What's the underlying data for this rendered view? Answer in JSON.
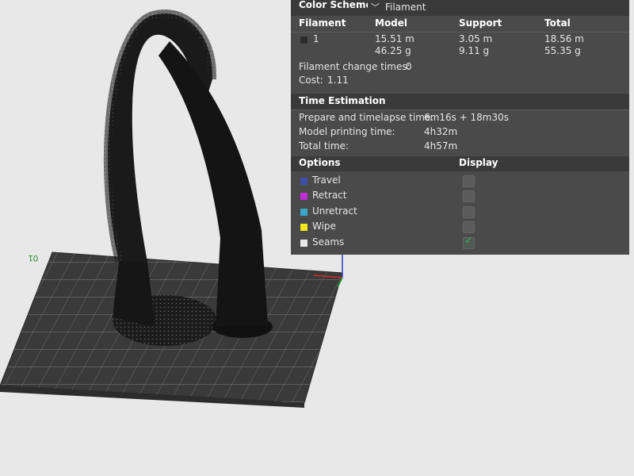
{
  "header": {
    "color_scheme_label": "Color Scheme",
    "color_scheme_value": "Filament"
  },
  "table": {
    "columns": [
      "Filament",
      "Model",
      "Support",
      "Total"
    ],
    "rows": [
      {
        "filament": "1",
        "model_length": "15.51 m",
        "model_weight": "46.25 g",
        "support_length": "3.05 m",
        "support_weight": "9.11 g",
        "total_length": "18.56 m",
        "total_weight": "55.35 g",
        "color": "#2b2b2b"
      }
    ]
  },
  "filament_change": {
    "label": "Filament change times:",
    "value": "0"
  },
  "cost": {
    "label": "Cost:",
    "value": "1.11"
  },
  "time_estimation": {
    "title": "Time Estimation",
    "prepare_label": "Prepare and timelapse time:",
    "prepare_value": "6m16s + 18m30s",
    "model_label": "Model printing time:",
    "model_value": "4h32m",
    "total_label": "Total time:",
    "total_value": "4h57m"
  },
  "options": {
    "header": "Options",
    "display_header": "Display",
    "items": [
      {
        "label": "Travel",
        "color": "#3c4fa8",
        "checked": false
      },
      {
        "label": "Retract",
        "color": "#c02ed6",
        "checked": false
      },
      {
        "label": "Unretract",
        "color": "#3aa6c8",
        "checked": false
      },
      {
        "label": "Wipe",
        "color": "#f2e81a",
        "checked": false
      },
      {
        "label": "Seams",
        "color": "#e8e8e8",
        "checked": true
      }
    ]
  },
  "viewport": {
    "plate_label": "01",
    "model_color": "#1a1a1a",
    "plate_color": "#3a3a3a",
    "background_color": "#e8e8e8"
  }
}
